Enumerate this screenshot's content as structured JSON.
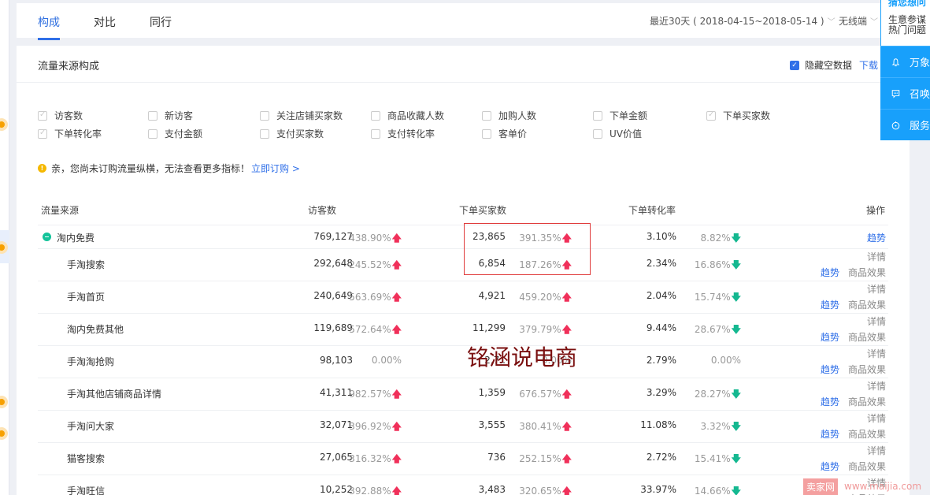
{
  "tabs": [
    {
      "label": "构成",
      "active": true
    },
    {
      "label": "对比",
      "active": false
    },
    {
      "label": "同行",
      "active": false
    }
  ],
  "date_range": "最近30天 ( 2018-04-15~2018-05-14 )",
  "device": "无线端",
  "section": {
    "title": "流量来源构成",
    "hide_empty_label": "隐藏空数据",
    "hide_empty_checked": true,
    "download_label": "下载"
  },
  "metrics": [
    {
      "label": "访客数",
      "checked": true
    },
    {
      "label": "新访客",
      "checked": false
    },
    {
      "label": "关注店铺买家数",
      "checked": false
    },
    {
      "label": "商品收藏人数",
      "checked": false
    },
    {
      "label": "加购人数",
      "checked": false
    },
    {
      "label": "下单金额",
      "checked": false
    },
    {
      "label": "下单买家数",
      "checked": true
    },
    {
      "label": "下单转化率",
      "checked": true
    },
    {
      "label": "支付金额",
      "checked": false
    },
    {
      "label": "支付买家数",
      "checked": false
    },
    {
      "label": "支付转化率",
      "checked": false
    },
    {
      "label": "客单价",
      "checked": false
    },
    {
      "label": "UV价值",
      "checked": false
    }
  ],
  "notice": {
    "text": "亲，您尚未订购流量纵横，无法查看更多指标！",
    "link": "立即订购 >"
  },
  "table": {
    "headers": {
      "source": "流量来源",
      "visitors": "访客数",
      "buyers": "下单买家数",
      "conversion": "下单转化率",
      "ops": "操作"
    },
    "rows": [
      {
        "source": "淘内免费",
        "parent": true,
        "visitors": "769,127",
        "visitors_change": "438.90%",
        "visitors_dir": "up",
        "buyers": "23,865",
        "buyers_change": "391.35%",
        "buyers_dir": "up",
        "conversion": "3.10%",
        "conversion_change": "8.82%",
        "conversion_dir": "down"
      },
      {
        "source": "手淘搜索",
        "visitors": "292,648",
        "visitors_change": "245.52%",
        "visitors_dir": "up",
        "buyers": "6,854",
        "buyers_change": "187.26%",
        "buyers_dir": "up",
        "conversion": "2.34%",
        "conversion_change": "16.86%",
        "conversion_dir": "down"
      },
      {
        "source": "手淘首页",
        "visitors": "240,649",
        "visitors_change": "563.69%",
        "visitors_dir": "up",
        "buyers": "4,921",
        "buyers_change": "459.20%",
        "buyers_dir": "up",
        "conversion": "2.04%",
        "conversion_change": "15.74%",
        "conversion_dir": "down"
      },
      {
        "source": "淘内免费其他",
        "visitors": "119,689",
        "visitors_change": "572.64%",
        "visitors_dir": "up",
        "buyers": "11,299",
        "buyers_change": "379.79%",
        "buyers_dir": "up",
        "conversion": "9.44%",
        "conversion_change": "28.67%",
        "conversion_dir": "down"
      },
      {
        "source": "手淘淘抢购",
        "visitors": "98,103",
        "visitors_change": "0.00%",
        "visitors_dir": "",
        "buyers": "2,7..",
        "buyers_change": "0.00%",
        "buyers_dir": "",
        "conversion": "2.79%",
        "conversion_change": "0.00%",
        "conversion_dir": ""
      },
      {
        "source": "手淘其他店铺商品详情",
        "visitors": "41,311",
        "visitors_change": "982.57%",
        "visitors_dir": "up",
        "buyers": "1,359",
        "buyers_change": "676.57%",
        "buyers_dir": "up",
        "conversion": "3.29%",
        "conversion_change": "28.27%",
        "conversion_dir": "down"
      },
      {
        "source": "手淘问大家",
        "visitors": "32,071",
        "visitors_change": "396.92%",
        "visitors_dir": "up",
        "buyers": "3,555",
        "buyers_change": "380.41%",
        "buyers_dir": "up",
        "conversion": "11.08%",
        "conversion_change": "3.32%",
        "conversion_dir": "down"
      },
      {
        "source": "猫客搜索",
        "visitors": "27,065",
        "visitors_change": "316.32%",
        "visitors_dir": "up",
        "buyers": "736",
        "buyers_change": "252.15%",
        "buyers_dir": "up",
        "conversion": "2.72%",
        "conversion_change": "15.41%",
        "conversion_dir": "down"
      },
      {
        "source": "手淘旺信",
        "visitors": "10,252",
        "visitors_change": "392.88%",
        "visitors_dir": "up",
        "buyers": "3,483",
        "buyers_change": "320.65%",
        "buyers_dir": "up",
        "conversion": "33.97%",
        "conversion_change": "14.66%",
        "conversion_dir": "down"
      }
    ],
    "ops": {
      "trend": "趋势",
      "detail": "详情",
      "effect": "商品效果"
    }
  },
  "watermark": "铭涵说电商",
  "right_panel": {
    "heading": "猜您想问",
    "text": "生意参谋热门问题",
    "buttons": [
      {
        "label": "万象",
        "icon": "bell-icon"
      },
      {
        "label": "召唤",
        "icon": "chat-icon"
      },
      {
        "label": "服务",
        "icon": "timer-icon"
      }
    ]
  },
  "footer_watermark": {
    "tag": "卖家网",
    "url": "www.maijia.com"
  },
  "colors": {
    "accent": "#2f6fe8",
    "up": "#f0305a",
    "down": "#14b890",
    "panel": "#18a0fb"
  }
}
